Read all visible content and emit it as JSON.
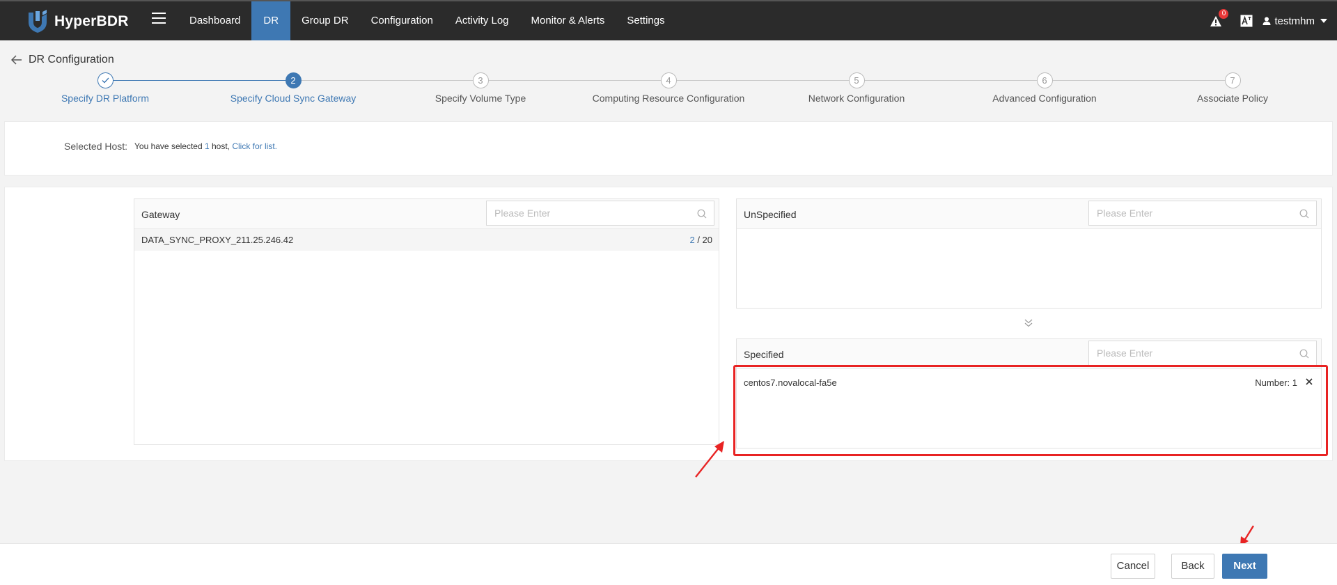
{
  "app": {
    "name": "HyperBDR"
  },
  "nav": {
    "items": [
      {
        "label": "Dashboard",
        "active": false
      },
      {
        "label": "DR",
        "active": true
      },
      {
        "label": "Group DR",
        "active": false
      },
      {
        "label": "Configuration",
        "active": false
      },
      {
        "label": "Activity Log",
        "active": false
      },
      {
        "label": "Monitor & Alerts",
        "active": false
      },
      {
        "label": "Settings",
        "active": false
      }
    ],
    "alert_count": "0",
    "username": "testmhm"
  },
  "page": {
    "title": "DR Configuration"
  },
  "steps": [
    {
      "number": "",
      "label": "Specify DR Platform",
      "state": "done"
    },
    {
      "number": "2",
      "label": "Specify Cloud Sync Gateway",
      "state": "current"
    },
    {
      "number": "3",
      "label": "Specify Volume Type",
      "state": "pending"
    },
    {
      "number": "4",
      "label": "Computing Resource Configuration",
      "state": "pending"
    },
    {
      "number": "5",
      "label": "Network Configuration",
      "state": "pending"
    },
    {
      "number": "6",
      "label": "Advanced Configuration",
      "state": "pending"
    },
    {
      "number": "7",
      "label": "Associate Policy",
      "state": "pending"
    }
  ],
  "host": {
    "label": "Selected Host:",
    "prefix": "You have selected ",
    "count": "1",
    "suffix": " host, ",
    "link": "Click for list."
  },
  "gateway": {
    "title": "Gateway",
    "placeholder": "Please Enter",
    "row": {
      "name": "DATA_SYNC_PROXY_211.25.246.42",
      "used": "2",
      "total": " / 20"
    }
  },
  "unspecified": {
    "title": "UnSpecified",
    "placeholder": "Please Enter"
  },
  "specified": {
    "title": "Specified",
    "placeholder": "Please Enter",
    "row": {
      "name": "centos7.novalocal-fa5e",
      "number": "Number: 1"
    }
  },
  "footer": {
    "cancel": "Cancel",
    "back": "Back",
    "next": "Next"
  },
  "colors": {
    "accent": "#3e78b3",
    "topbar": "#2b2b2b",
    "annotation": "#e82323"
  }
}
